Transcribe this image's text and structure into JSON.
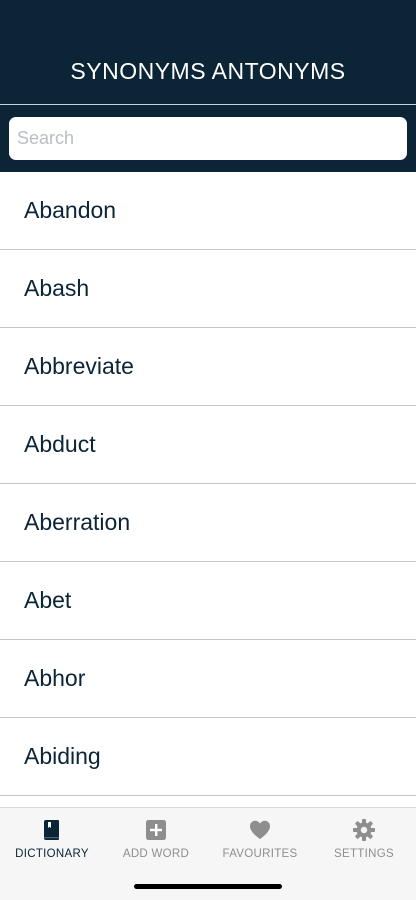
{
  "header": {
    "title": "SYNONYMS ANTONYMS"
  },
  "search": {
    "placeholder": "Search",
    "value": ""
  },
  "words": [
    {
      "label": "Abandon"
    },
    {
      "label": "Abash"
    },
    {
      "label": "Abbreviate"
    },
    {
      "label": "Abduct"
    },
    {
      "label": "Aberration"
    },
    {
      "label": "Abet"
    },
    {
      "label": "Abhor"
    },
    {
      "label": "Abiding"
    }
  ],
  "tabbar": {
    "tabs": [
      {
        "label": "DICTIONARY",
        "icon": "book-icon",
        "active": true
      },
      {
        "label": "ADD WORD",
        "icon": "add-square-icon",
        "active": false
      },
      {
        "label": "FAVOURITES",
        "icon": "heart-icon",
        "active": false
      },
      {
        "label": "SETTINGS",
        "icon": "gear-icon",
        "active": false
      }
    ]
  },
  "colors": {
    "header_bg": "#0b2436",
    "active_tab": "#0b2436",
    "inactive_tab": "#8e8e8e"
  }
}
